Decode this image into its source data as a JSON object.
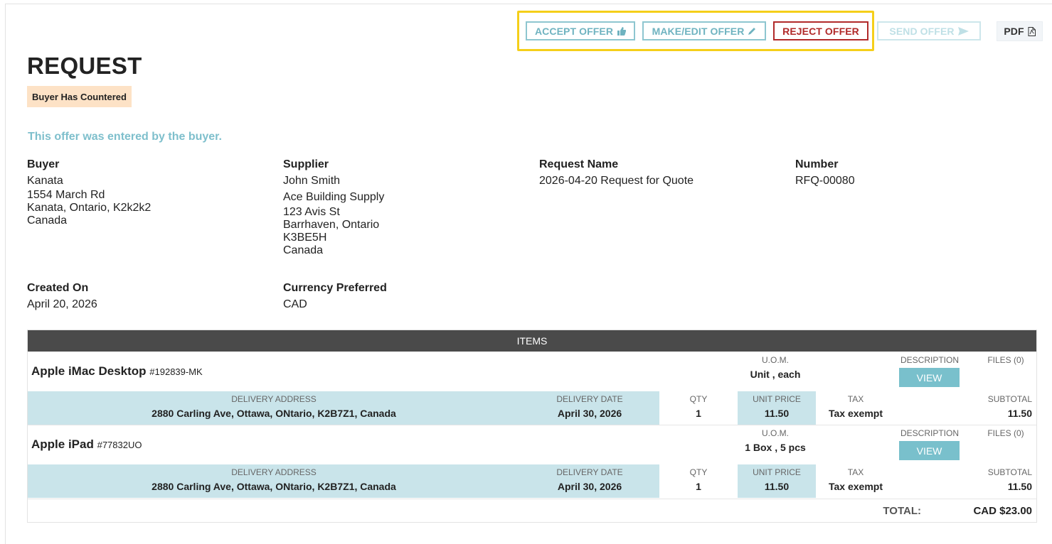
{
  "toolbar": {
    "accept_label": "ACCEPT OFFER",
    "make_edit_label": "MAKE/EDIT OFFER",
    "reject_label": "REJECT OFFER",
    "send_label": "SEND OFFER",
    "pdf_label": "PDF"
  },
  "header": {
    "title": "REQUEST",
    "status_badge": "Buyer Has Countered",
    "note": "This offer was entered by the buyer."
  },
  "buyer": {
    "heading": "Buyer",
    "lines": [
      "Kanata",
      "1554 March Rd",
      "Kanata, Ontario, K2k2k2",
      "Canada"
    ]
  },
  "supplier": {
    "heading": "Supplier",
    "lines": [
      "John Smith",
      "Ace Building Supply",
      "123 Avis St",
      "Barrhaven, Ontario",
      "K3BE5H",
      "Canada"
    ]
  },
  "request_name": {
    "heading": "Request Name",
    "value": "2026-04-20 Request for Quote"
  },
  "number": {
    "heading": "Number",
    "value": "RFQ-00080"
  },
  "created_on": {
    "heading": "Created On",
    "value": "April 20, 2026"
  },
  "currency": {
    "heading": "Currency Preferred",
    "value": "CAD"
  },
  "items": {
    "header": "ITEMS",
    "labels": {
      "uom": "U.O.M.",
      "description": "DESCRIPTION",
      "delivery_address": "DELIVERY ADDRESS",
      "delivery_date": "DELIVERY DATE",
      "qty": "QTY",
      "unit_price": "UNIT PRICE",
      "tax": "TAX",
      "subtotal": "SUBTOTAL",
      "view": "VIEW"
    },
    "rows": [
      {
        "name": "Apple iMac Desktop",
        "sku": "#192839-MK",
        "uom": "Unit , each",
        "files": "FILES (0)",
        "delivery_address": "2880 Carling Ave, Ottawa, ONtario, K2B7Z1, Canada",
        "delivery_date": "April 30, 2026",
        "qty": "1",
        "unit_price": "11.50",
        "tax": "Tax exempt",
        "subtotal": "11.50"
      },
      {
        "name": "Apple iPad",
        "sku": "#77832UO",
        "uom": "1 Box , 5 pcs",
        "files": "FILES (0)",
        "delivery_address": "2880 Carling Ave, Ottawa, ONtario, K2B7Z1, Canada",
        "delivery_date": "April 30, 2026",
        "qty": "1",
        "unit_price": "11.50",
        "tax": "Tax exempt",
        "subtotal": "11.50"
      }
    ],
    "total_label": "TOTAL:",
    "total_value": "CAD $23.00"
  },
  "colors": {
    "accent_teal": "#79c0cc",
    "reject_red": "#b12a2a",
    "badge_bg": "#fde2c6",
    "highlight_yellow": "#f5cf1a",
    "items_header_bg": "#4a4a4a",
    "row_shade": "#c9e4ea"
  }
}
